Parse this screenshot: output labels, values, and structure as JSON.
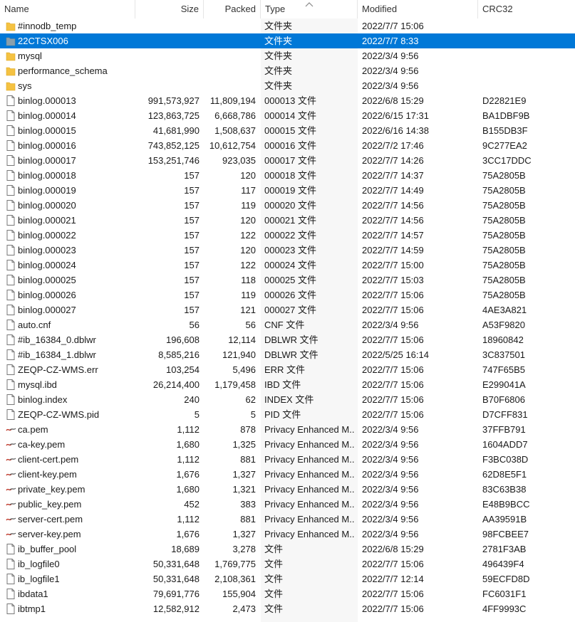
{
  "columns": {
    "name": "Name",
    "size": "Size",
    "packed": "Packed",
    "type": "Type",
    "modified": "Modified",
    "crc": "CRC32"
  },
  "colors": {
    "selection": "#0078d7",
    "folder": "#f5c242",
    "selected_folder": "#8aa0ad"
  },
  "rows": [
    {
      "icon": "folder",
      "name": "#innodb_temp",
      "size": "",
      "packed": "",
      "type": "文件夹",
      "modified": "2022/7/7 15:06",
      "crc": ""
    },
    {
      "icon": "folder",
      "name": "22CTSX006",
      "size": "",
      "packed": "",
      "type": "文件夹",
      "modified": "2022/7/7 8:33",
      "crc": "",
      "selected": true
    },
    {
      "icon": "folder",
      "name": "mysql",
      "size": "",
      "packed": "",
      "type": "文件夹",
      "modified": "2022/3/4 9:56",
      "crc": ""
    },
    {
      "icon": "folder",
      "name": "performance_schema",
      "size": "",
      "packed": "",
      "type": "文件夹",
      "modified": "2022/3/4 9:56",
      "crc": ""
    },
    {
      "icon": "folder",
      "name": "sys",
      "size": "",
      "packed": "",
      "type": "文件夹",
      "modified": "2022/3/4 9:56",
      "crc": ""
    },
    {
      "icon": "file",
      "name": "binlog.000013",
      "size": "991,573,927",
      "packed": "11,809,194",
      "type": "000013 文件",
      "modified": "2022/6/8 15:29",
      "crc": "D22821E9"
    },
    {
      "icon": "file",
      "name": "binlog.000014",
      "size": "123,863,725",
      "packed": "6,668,786",
      "type": "000014 文件",
      "modified": "2022/6/15 17:31",
      "crc": "BA1DBF9B"
    },
    {
      "icon": "file",
      "name": "binlog.000015",
      "size": "41,681,990",
      "packed": "1,508,637",
      "type": "000015 文件",
      "modified": "2022/6/16 14:38",
      "crc": "B155DB3F"
    },
    {
      "icon": "file",
      "name": "binlog.000016",
      "size": "743,852,125",
      "packed": "10,612,754",
      "type": "000016 文件",
      "modified": "2022/7/2 17:46",
      "crc": "9C277EA2"
    },
    {
      "icon": "file",
      "name": "binlog.000017",
      "size": "153,251,746",
      "packed": "923,035",
      "type": "000017 文件",
      "modified": "2022/7/7 14:26",
      "crc": "3CC17DDC"
    },
    {
      "icon": "file",
      "name": "binlog.000018",
      "size": "157",
      "packed": "120",
      "type": "000018 文件",
      "modified": "2022/7/7 14:37",
      "crc": "75A2805B"
    },
    {
      "icon": "file",
      "name": "binlog.000019",
      "size": "157",
      "packed": "117",
      "type": "000019 文件",
      "modified": "2022/7/7 14:49",
      "crc": "75A2805B"
    },
    {
      "icon": "file",
      "name": "binlog.000020",
      "size": "157",
      "packed": "119",
      "type": "000020 文件",
      "modified": "2022/7/7 14:56",
      "crc": "75A2805B"
    },
    {
      "icon": "file",
      "name": "binlog.000021",
      "size": "157",
      "packed": "120",
      "type": "000021 文件",
      "modified": "2022/7/7 14:56",
      "crc": "75A2805B"
    },
    {
      "icon": "file",
      "name": "binlog.000022",
      "size": "157",
      "packed": "122",
      "type": "000022 文件",
      "modified": "2022/7/7 14:57",
      "crc": "75A2805B"
    },
    {
      "icon": "file",
      "name": "binlog.000023",
      "size": "157",
      "packed": "120",
      "type": "000023 文件",
      "modified": "2022/7/7 14:59",
      "crc": "75A2805B"
    },
    {
      "icon": "file",
      "name": "binlog.000024",
      "size": "157",
      "packed": "122",
      "type": "000024 文件",
      "modified": "2022/7/7 15:00",
      "crc": "75A2805B"
    },
    {
      "icon": "file",
      "name": "binlog.000025",
      "size": "157",
      "packed": "118",
      "type": "000025 文件",
      "modified": "2022/7/7 15:03",
      "crc": "75A2805B"
    },
    {
      "icon": "file",
      "name": "binlog.000026",
      "size": "157",
      "packed": "119",
      "type": "000026 文件",
      "modified": "2022/7/7 15:06",
      "crc": "75A2805B"
    },
    {
      "icon": "file",
      "name": "binlog.000027",
      "size": "157",
      "packed": "121",
      "type": "000027 文件",
      "modified": "2022/7/7 15:06",
      "crc": "4AE3A821"
    },
    {
      "icon": "file",
      "name": "auto.cnf",
      "size": "56",
      "packed": "56",
      "type": "CNF 文件",
      "modified": "2022/3/4 9:56",
      "crc": "A53F9820"
    },
    {
      "icon": "file",
      "name": "#ib_16384_0.dblwr",
      "size": "196,608",
      "packed": "12,114",
      "type": "DBLWR 文件",
      "modified": "2022/7/7 15:06",
      "crc": "18960842"
    },
    {
      "icon": "file",
      "name": "#ib_16384_1.dblwr",
      "size": "8,585,216",
      "packed": "121,940",
      "type": "DBLWR 文件",
      "modified": "2022/5/25 16:14",
      "crc": "3C837501"
    },
    {
      "icon": "file",
      "name": "ZEQP-CZ-WMS.err",
      "size": "103,254",
      "packed": "5,496",
      "type": "ERR 文件",
      "modified": "2022/7/7 15:06",
      "crc": "747F65B5"
    },
    {
      "icon": "file",
      "name": "mysql.ibd",
      "size": "26,214,400",
      "packed": "1,179,458",
      "type": "IBD 文件",
      "modified": "2022/7/7 15:06",
      "crc": "E299041A"
    },
    {
      "icon": "file",
      "name": "binlog.index",
      "size": "240",
      "packed": "62",
      "type": "INDEX 文件",
      "modified": "2022/7/7 15:06",
      "crc": "B70F6806"
    },
    {
      "icon": "file",
      "name": "ZEQP-CZ-WMS.pid",
      "size": "5",
      "packed": "5",
      "type": "PID 文件",
      "modified": "2022/7/7 15:06",
      "crc": "D7CFF831"
    },
    {
      "icon": "cert",
      "name": "ca.pem",
      "size": "1,112",
      "packed": "878",
      "type": "Privacy Enhanced M...",
      "modified": "2022/3/4 9:56",
      "crc": "37FFB791"
    },
    {
      "icon": "cert",
      "name": "ca-key.pem",
      "size": "1,680",
      "packed": "1,325",
      "type": "Privacy Enhanced M...",
      "modified": "2022/3/4 9:56",
      "crc": "1604ADD7"
    },
    {
      "icon": "cert",
      "name": "client-cert.pem",
      "size": "1,112",
      "packed": "881",
      "type": "Privacy Enhanced M...",
      "modified": "2022/3/4 9:56",
      "crc": "F3BC038D"
    },
    {
      "icon": "cert",
      "name": "client-key.pem",
      "size": "1,676",
      "packed": "1,327",
      "type": "Privacy Enhanced M...",
      "modified": "2022/3/4 9:56",
      "crc": "62D8E5F1"
    },
    {
      "icon": "cert",
      "name": "private_key.pem",
      "size": "1,680",
      "packed": "1,321",
      "type": "Privacy Enhanced M...",
      "modified": "2022/3/4 9:56",
      "crc": "83C63B38"
    },
    {
      "icon": "cert",
      "name": "public_key.pem",
      "size": "452",
      "packed": "383",
      "type": "Privacy Enhanced M...",
      "modified": "2022/3/4 9:56",
      "crc": "E48B9BCC"
    },
    {
      "icon": "cert",
      "name": "server-cert.pem",
      "size": "1,112",
      "packed": "881",
      "type": "Privacy Enhanced M...",
      "modified": "2022/3/4 9:56",
      "crc": "AA39591B"
    },
    {
      "icon": "cert",
      "name": "server-key.pem",
      "size": "1,676",
      "packed": "1,327",
      "type": "Privacy Enhanced M...",
      "modified": "2022/3/4 9:56",
      "crc": "98FCBEE7"
    },
    {
      "icon": "file",
      "name": "ib_buffer_pool",
      "size": "18,689",
      "packed": "3,278",
      "type": "文件",
      "modified": "2022/6/8 15:29",
      "crc": "2781F3AB"
    },
    {
      "icon": "file",
      "name": "ib_logfile0",
      "size": "50,331,648",
      "packed": "1,769,775",
      "type": "文件",
      "modified": "2022/7/7 15:06",
      "crc": "496439F4"
    },
    {
      "icon": "file",
      "name": "ib_logfile1",
      "size": "50,331,648",
      "packed": "2,108,361",
      "type": "文件",
      "modified": "2022/7/7 12:14",
      "crc": "59ECFD8D"
    },
    {
      "icon": "file",
      "name": "ibdata1",
      "size": "79,691,776",
      "packed": "155,904",
      "type": "文件",
      "modified": "2022/7/7 15:06",
      "crc": "FC6031F1"
    },
    {
      "icon": "file",
      "name": "ibtmp1",
      "size": "12,582,912",
      "packed": "2,473",
      "type": "文件",
      "modified": "2022/7/7 15:06",
      "crc": "4FF9993C"
    }
  ]
}
